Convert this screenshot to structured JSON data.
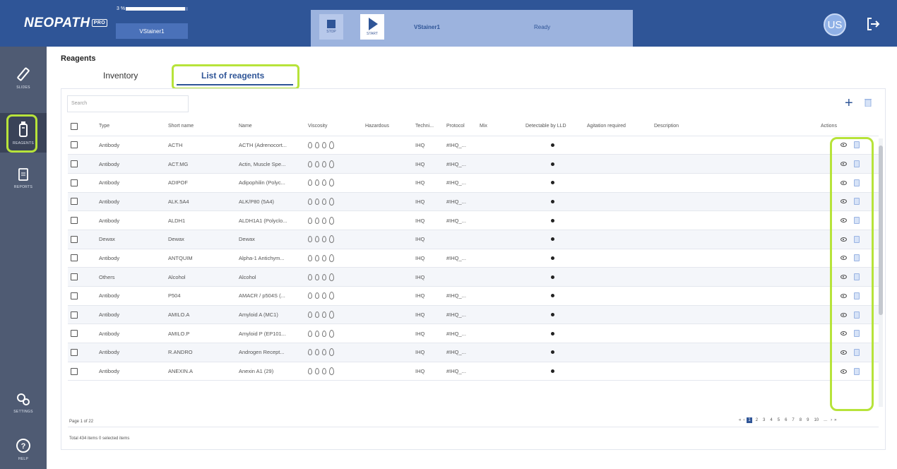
{
  "app": {
    "logo": "NEOPATH",
    "logo_badge": "PRO",
    "progress_label": "3 %",
    "progress_fraction": 0.95,
    "stainer_tab": "VStainer1"
  },
  "controls": {
    "stop_label": "STOP",
    "start_label": "START",
    "stainer_name": "VStainer1",
    "status": "Ready"
  },
  "user": {
    "initials": "US"
  },
  "sidebar": {
    "items": [
      {
        "label": "SLIDES",
        "icon": "slide-icon"
      },
      {
        "label": "REAGENTS",
        "icon": "reagent-bottle-icon",
        "active": true
      },
      {
        "label": "REPORTS",
        "icon": "report-icon"
      },
      {
        "label": "SETTINGS",
        "icon": "gears-icon"
      },
      {
        "label": "HELP",
        "icon": "help-icon"
      }
    ]
  },
  "page": {
    "title": "Reagents",
    "tabs": [
      "Inventory",
      "List of reagents"
    ],
    "search_placeholder": "Search"
  },
  "table": {
    "columns": [
      "Type",
      "Short name",
      "Name",
      "Viscosity",
      "Hazardous",
      "Techni...",
      "Protocol",
      "Mix",
      "Detectable by LLD",
      "Agitation required",
      "Description",
      "Actions"
    ],
    "rows": [
      {
        "type": "Antibody",
        "short": "ACTH",
        "name": "ACTH (Adrenocort...",
        "tech": "IHQ",
        "protocol": "#IHQ_..."
      },
      {
        "type": "Antibody",
        "short": "ACT.MG",
        "name": "Actin, Muscle Spe...",
        "tech": "IHQ",
        "protocol": "#IHQ_..."
      },
      {
        "type": "Antibody",
        "short": "ADIPOF",
        "name": "Adipophilin (Polyc...",
        "tech": "IHQ",
        "protocol": "#IHQ_..."
      },
      {
        "type": "Antibody",
        "short": "ALK.5A4",
        "name": "ALK/P80 (5A4)",
        "tech": "IHQ",
        "protocol": "#IHQ_..."
      },
      {
        "type": "Antibody",
        "short": "ALDH1",
        "name": "ALDH1A1 (Polyclo...",
        "tech": "IHQ",
        "protocol": "#IHQ_..."
      },
      {
        "type": "Dewax",
        "short": "Dewax",
        "name": "Dewax",
        "tech": "IHQ",
        "protocol": ""
      },
      {
        "type": "Antibody",
        "short": "ANTQUIM",
        "name": "Alpha-1 Antichym...",
        "tech": "IHQ",
        "protocol": "#IHQ_..."
      },
      {
        "type": "Others",
        "short": "Alcohol",
        "name": "Alcohol",
        "tech": "IHQ",
        "protocol": ""
      },
      {
        "type": "Antibody",
        "short": "P504",
        "name": "AMACR / p504S (...",
        "tech": "IHQ",
        "protocol": "#IHQ_..."
      },
      {
        "type": "Antibody",
        "short": "AMILO.A",
        "name": "Amyloid A (MC1)",
        "tech": "IHQ",
        "protocol": "#IHQ_..."
      },
      {
        "type": "Antibody",
        "short": "AMILO.P",
        "name": "Amyloid P (EP101...",
        "tech": "IHQ",
        "protocol": "#IHQ_..."
      },
      {
        "type": "Antibody",
        "short": "R.ANDRO",
        "name": "Androgen Recept...",
        "tech": "IHQ",
        "protocol": "#IHQ_..."
      },
      {
        "type": "Antibody",
        "short": "ANEXIN.A",
        "name": "Anexin A1 (29)",
        "tech": "IHQ",
        "protocol": "#IHQ_..."
      }
    ]
  },
  "footer": {
    "page_info": "Page 1 of 22",
    "total_info": "Total 434 items   0 selected items",
    "pages": [
      "1",
      "2",
      "3",
      "4",
      "5",
      "6",
      "7",
      "8",
      "9",
      "10",
      "..."
    ]
  }
}
